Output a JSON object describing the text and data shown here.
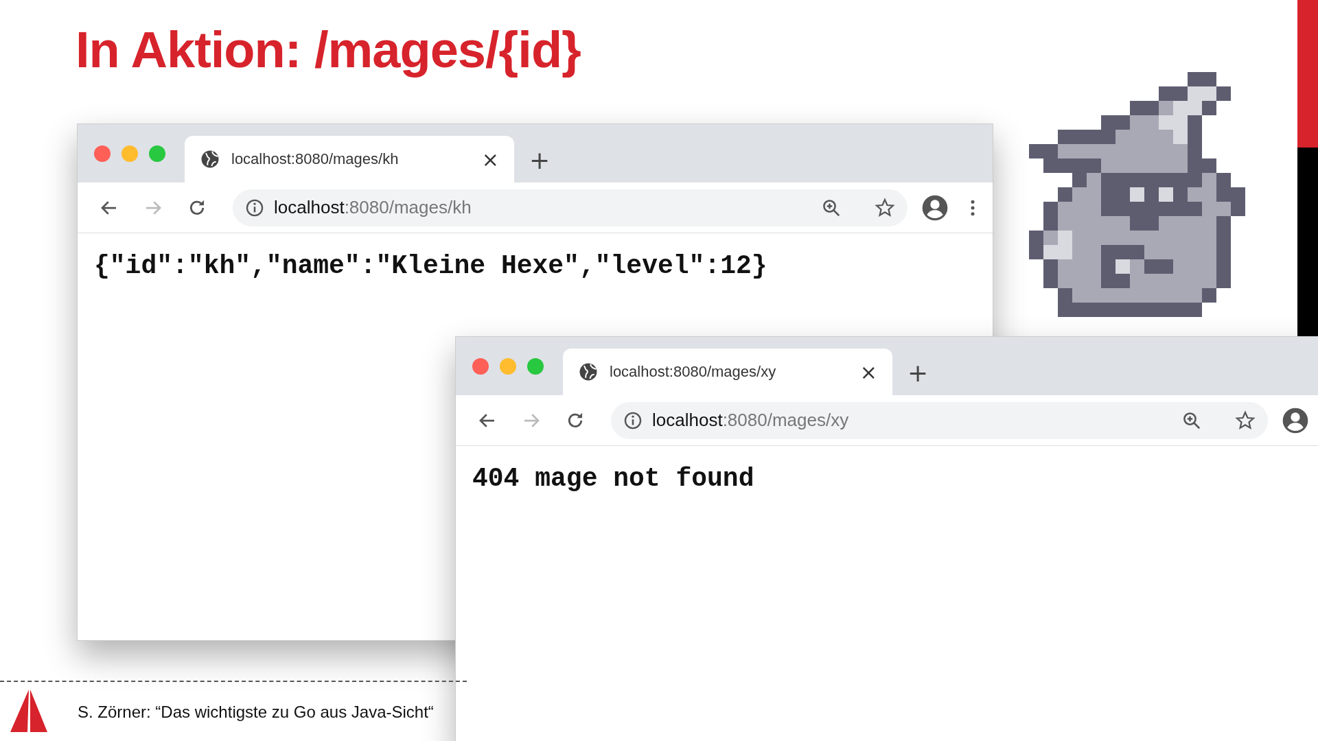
{
  "slide": {
    "title": "In Aktion: /mages/{id}",
    "footer": "S. Zörner: “Das wichtigste zu Go aus Java-Sicht“"
  },
  "windows": [
    {
      "tab": {
        "title": "localhost:8080/mages/kh",
        "close": "×",
        "new_tab": "+"
      },
      "address": {
        "host": "localhost",
        "path": ":8080/mages/kh"
      },
      "menu": true,
      "body": "{\"id\":\"kh\",\"name\":\"Kleine Hexe\",\"level\":12}"
    },
    {
      "tab": {
        "title": "localhost:8080/mages/xy",
        "close": "×",
        "new_tab": "+"
      },
      "address": {
        "host": "localhost",
        "path": ":8080/mages/xy"
      },
      "menu": false,
      "body": "404 mage not found"
    }
  ]
}
